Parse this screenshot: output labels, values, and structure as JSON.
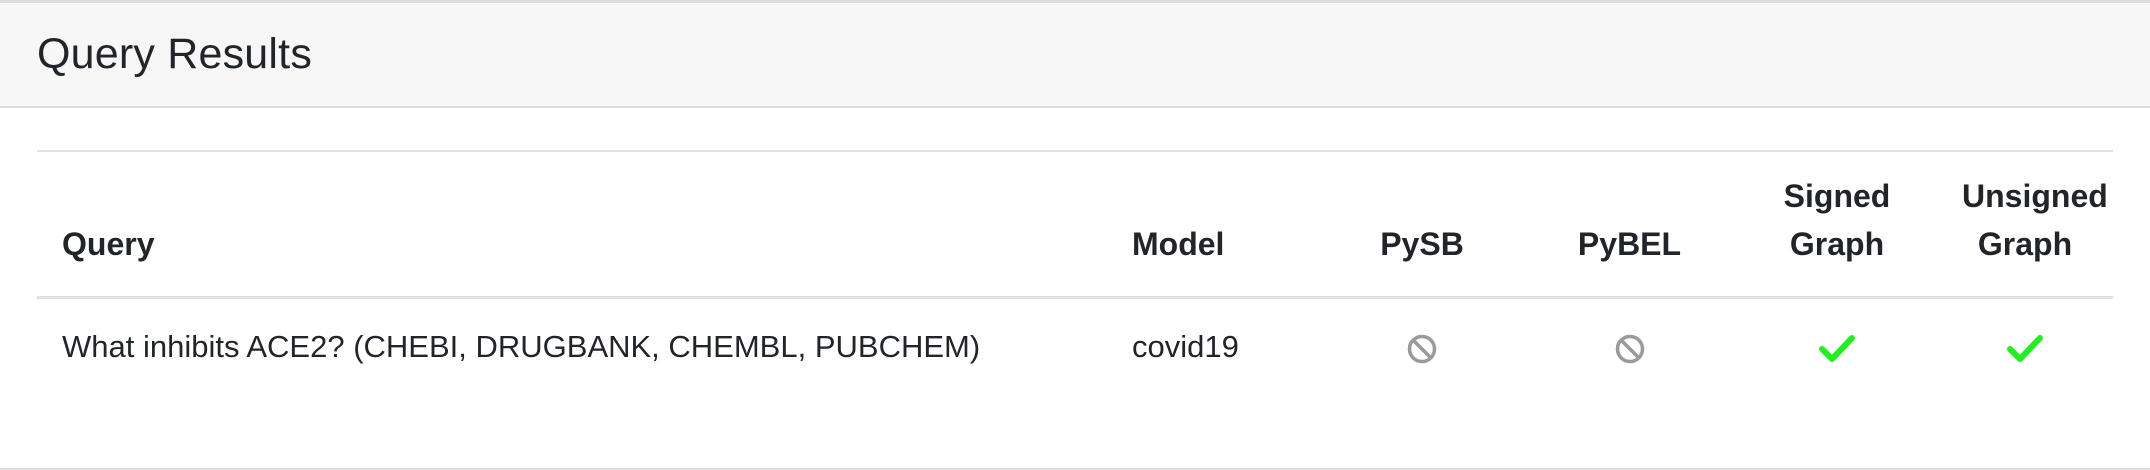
{
  "panel": {
    "title": "Query Results"
  },
  "table": {
    "headers": {
      "query": "Query",
      "model": "Model",
      "pysb": "PySB",
      "pybel": "PyBEL",
      "signed_line1": "Signed",
      "signed_line2": "Graph",
      "unsigned_line1": "Unsigned",
      "unsigned_line2": "Graph"
    },
    "rows": [
      {
        "query": "What inhibits ACE2? (CHEBI, DRUGBANK, CHEMBL, PUBCHEM)",
        "model": "covid19",
        "pysb": "ban-icon",
        "pybel": "ban-icon",
        "signed_graph": "check-icon",
        "unsigned_graph": "check-icon"
      }
    ]
  },
  "colors": {
    "check": "#22ee22",
    "ban": "#9a9a9a",
    "header_bg": "#f7f7f7",
    "border": "#dee2e6"
  }
}
